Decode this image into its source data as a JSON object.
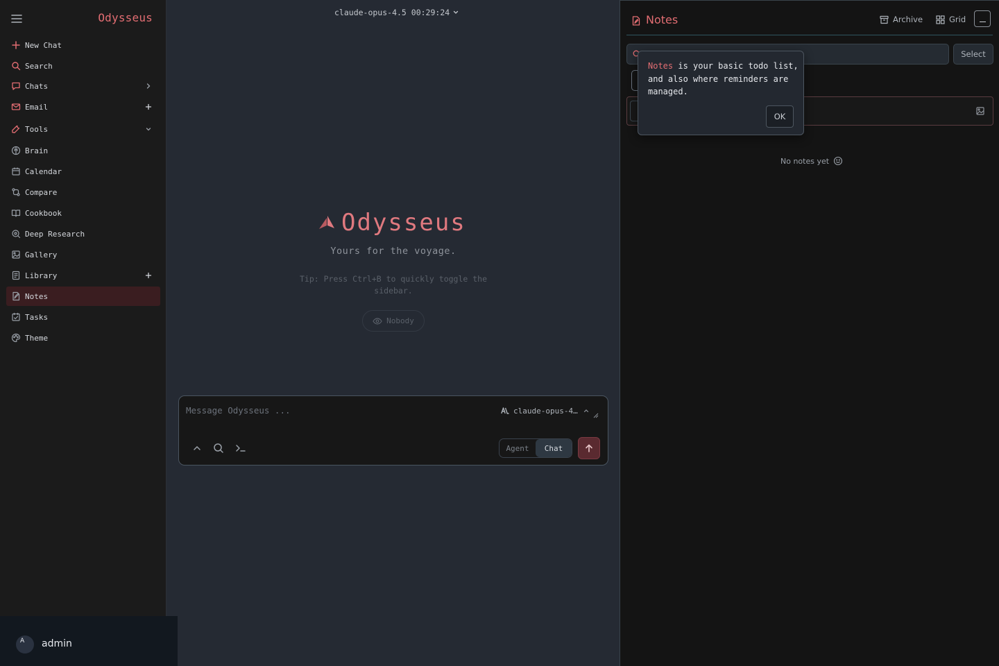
{
  "sidebar": {
    "brand": "Odysseus",
    "items": [
      {
        "label": "New Chat",
        "icon": "plus-icon",
        "trailing": ""
      },
      {
        "label": "Search",
        "icon": "search-icon",
        "trailing": ""
      },
      {
        "label": "Chats",
        "icon": "chat-bubble-icon",
        "trailing": "chevron-right-icon"
      },
      {
        "label": "Email",
        "icon": "mail-icon",
        "trailing": "plus-icon"
      },
      {
        "label": "Tools",
        "icon": "wrench-icon",
        "trailing": "chevron-down-icon"
      },
      {
        "label": "Brain",
        "icon": "brain-icon",
        "trailing": ""
      },
      {
        "label": "Calendar",
        "icon": "calendar-icon",
        "trailing": ""
      },
      {
        "label": "Compare",
        "icon": "compare-icon",
        "trailing": ""
      },
      {
        "label": "Cookbook",
        "icon": "book-icon",
        "trailing": ""
      },
      {
        "label": "Deep Research",
        "icon": "research-icon",
        "trailing": ""
      },
      {
        "label": "Gallery",
        "icon": "image-icon",
        "trailing": ""
      },
      {
        "label": "Library",
        "icon": "library-icon",
        "trailing": "plus-icon"
      },
      {
        "label": "Notes",
        "icon": "note-icon",
        "trailing": "",
        "active": true
      },
      {
        "label": "Tasks",
        "icon": "tasks-icon",
        "trailing": ""
      },
      {
        "label": "Theme",
        "icon": "palette-icon",
        "trailing": ""
      }
    ],
    "user": {
      "avatar_letter": "A",
      "name": "admin"
    }
  },
  "main": {
    "model_header": "claude-opus-4.5 00:29:24",
    "hero_title": "Odysseus",
    "tagline": "Yours for the voyage.",
    "tip": "Tip: Press Ctrl+B to quickly toggle the sidebar.",
    "visibility": "Nobody",
    "composer": {
      "placeholder": "Message Odysseus ...",
      "model": "claude-opus-4…",
      "mode_agent": "Agent",
      "mode_chat": "Chat",
      "active_mode": "Chat"
    }
  },
  "notes": {
    "title": "Notes",
    "archive_label": "Archive",
    "grid_label": "Grid",
    "select_label": "Select",
    "empty_state": "No notes yet",
    "tooltip": {
      "highlight": "Notes",
      "text": " is your basic todo list, and also where reminders are managed.",
      "ok_label": "OK"
    }
  },
  "colors": {
    "accent": "#e26d72",
    "sidebar_bg": "#1b1b1b",
    "main_bg": "#252a33",
    "panel_bg": "#141414",
    "active_item_bg": "#3a1d20",
    "send_button_bg": "#5a2a30"
  }
}
